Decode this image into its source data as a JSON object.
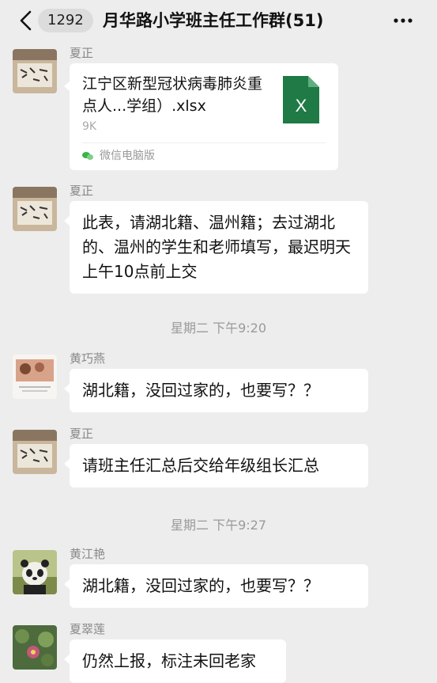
{
  "header": {
    "unread_count": "1292",
    "title": "月华路小学班主任工作群(51)"
  },
  "messages": [
    {
      "sender": "夏正",
      "type": "file",
      "file_name": "江宁区新型冠状病毒肺炎重点人...学组）.xlsx",
      "file_size": "9K",
      "file_icon_letter": "X",
      "source": "微信电脑版"
    },
    {
      "sender": "夏正",
      "type": "text",
      "text": "此表，请湖北籍、温州籍；去过湖北的、温州的学生和老师填写，最迟明天上午10点前上交"
    },
    {
      "type": "time",
      "text": "星期二 下午9:20"
    },
    {
      "sender": "黄巧燕",
      "type": "text",
      "text": "湖北籍，没回过家的，也要写？？"
    },
    {
      "sender": "夏正",
      "type": "text",
      "text": "请班主任汇总后交给年级组长汇总"
    },
    {
      "type": "time",
      "text": "星期二 下午9:27"
    },
    {
      "sender": "黄江艳",
      "type": "text",
      "text": "湖北籍，没回过家的，也要写？？"
    },
    {
      "sender": "夏翠莲",
      "type": "text",
      "text": "仍然上报，标注未回老家"
    }
  ],
  "colors": {
    "background": "#ededed",
    "bubble": "#ffffff",
    "excel_green": "#1f7a45",
    "meta_text": "#888888"
  },
  "icons": [
    "back-chevron-icon",
    "more-dots-icon",
    "excel-file-icon",
    "wechat-pc-icon"
  ]
}
